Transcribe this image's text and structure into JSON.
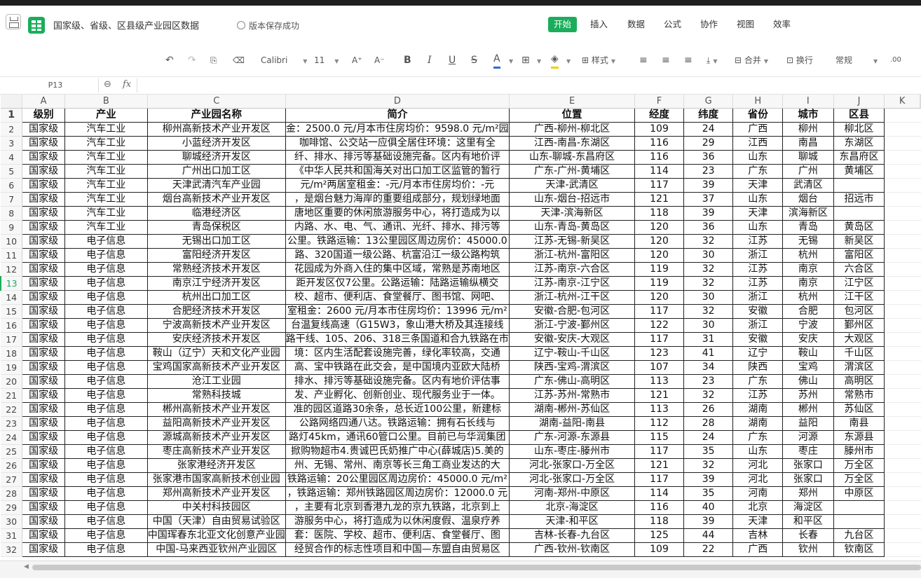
{
  "app": {
    "doc_title": "国家级、省级、区县级产业园区数据",
    "save_status": "版本保存成功",
    "menus": [
      "开始",
      "插入",
      "数据",
      "公式",
      "协作",
      "视图",
      "效率"
    ],
    "active_menu": "开始",
    "accent_color": "#1aad5b"
  },
  "toolbar": {
    "font_name": "Calibri",
    "font_size": "11",
    "style_label": "样式",
    "merge_label": "合并",
    "wrap_label": "换行",
    "format_label": "常规",
    "icons": [
      "undo-icon",
      "redo-icon",
      "format-painter-icon",
      "eraser-icon",
      "font-grow-icon",
      "font-shrink-icon",
      "bold-icon",
      "italic-icon",
      "underline-icon",
      "strikethrough-icon",
      "font-color-icon",
      "border-icon",
      "fill-color-icon",
      "align-left-icon",
      "align-center-icon",
      "align-right-icon",
      "valign-icon",
      "merge-icon",
      "wrap-icon",
      "decimal-icon"
    ]
  },
  "formula_bar": {
    "cell_ref": "P13",
    "fx": "fx",
    "value": ""
  },
  "sheet": {
    "columns": [
      "A",
      "B",
      "C",
      "D",
      "E",
      "F",
      "G",
      "H",
      "I",
      "J",
      "K"
    ],
    "selected_row": 13,
    "rows": [
      [
        "级别",
        "产业",
        "产业园名称",
        "简介",
        "位置",
        "经度",
        "纬度",
        "省份",
        "城市",
        "区县"
      ],
      [
        "国家级",
        "汽车工业",
        "柳州高新技术产业开发区",
        "金：2500.0 元/月本市住房均价：9598.0 元/m²园",
        "广西-柳州-柳北区",
        "109",
        "24",
        "广西",
        "柳州",
        "柳北区"
      ],
      [
        "国家级",
        "汽车工业",
        "小蓝经济开发区",
        "咖啡馆、公交站一应俱全居住环境：这里有全",
        "江西-南昌-东湖区",
        "116",
        "29",
        "江西",
        "南昌",
        "东湖区"
      ],
      [
        "国家级",
        "汽车工业",
        "聊城经济开发区",
        "纤、排水、排污等基础设施完备。区内有地价评",
        "山东-聊城-东昌府区",
        "116",
        "36",
        "山东",
        "聊城",
        "东昌府区"
      ],
      [
        "国家级",
        "汽车工业",
        "广州出口加工区",
        "《中华人民共和国海关对出口加工区监管的暂行",
        "广东-广州-黄埔区",
        "114",
        "23",
        "广东",
        "广州",
        "黄埔区"
      ],
      [
        "国家级",
        "汽车工业",
        "天津武清汽车产业园",
        "元/m²两居室租金：-元/月本市住房均价：-元",
        "天津-武清区",
        "117",
        "39",
        "天津",
        "武清区",
        ""
      ],
      [
        "国家级",
        "汽车工业",
        "烟台高新技术产业开发区",
        "，是烟台魅力海岸的重要组成部分，规划绿地面",
        "山东-烟台-招远市",
        "121",
        "37",
        "山东",
        "烟台",
        "招远市"
      ],
      [
        "国家级",
        "汽车工业",
        "临港经济区",
        "唐地区重要的休闲旅游服务中心，将打造成为以",
        "天津-滨海新区",
        "118",
        "39",
        "天津",
        "滨海新区",
        ""
      ],
      [
        "国家级",
        "汽车工业",
        "青岛保税区",
        "内路、水、电、气、通讯、光纤、排水、排污等",
        "山东-青岛-黄岛区",
        "120",
        "36",
        "山东",
        "青岛",
        "黄岛区"
      ],
      [
        "国家级",
        "电子信息",
        "无锡出口加工区",
        "公里。铁路运输：13公里园区周边房价：45000.0",
        "江苏-无锡-新吴区",
        "120",
        "32",
        "江苏",
        "无锡",
        "新吴区"
      ],
      [
        "国家级",
        "电子信息",
        "富阳经济开发区",
        "路、320国道一级公路、杭富沿江一级公路构筑",
        "浙江-杭州-富阳区",
        "120",
        "30",
        "浙江",
        "杭州",
        "富阳区"
      ],
      [
        "国家级",
        "电子信息",
        "常熟经济技术开发区",
        "花园成为外商入住的集中区域，常熟是苏南地区",
        "江苏-南京-六合区",
        "119",
        "32",
        "江苏",
        "南京",
        "六合区"
      ],
      [
        "国家级",
        "电子信息",
        "南京江宁经济开发区",
        "距开发区仅7公里。公路运输：陆路运输纵横交",
        "江苏-南京-江宁区",
        "119",
        "32",
        "江苏",
        "南京",
        "江宁区"
      ],
      [
        "国家级",
        "电子信息",
        "杭州出口加工区",
        "校、超市、便利店、食堂餐厅、图书馆、网吧、",
        "浙江-杭州-江干区",
        "120",
        "30",
        "浙江",
        "杭州",
        "江干区"
      ],
      [
        "国家级",
        "电子信息",
        "合肥经济技术开发区",
        "室租金：2600 元/月本市住房均价：13996 元/m²",
        "安徽-合肥-包河区",
        "117",
        "32",
        "安徽",
        "合肥",
        "包河区"
      ],
      [
        "国家级",
        "电子信息",
        "宁波高新技术产业开发区",
        "台温复线高速（G15W3，象山港大桥及其连接线",
        "浙江-宁波-鄞州区",
        "122",
        "30",
        "浙江",
        "宁波",
        "鄞州区"
      ],
      [
        "国家级",
        "电子信息",
        "安庆经济技术开发区",
        "路干线、105、206、318三条国道和合九铁路在市",
        "安徽-安庆-大观区",
        "117",
        "31",
        "安徽",
        "安庆",
        "大观区"
      ],
      [
        "国家级",
        "电子信息",
        "鞍山（辽宁）天和文化产业园",
        "境：区内生活配套设施完善，绿化率较高，交通",
        "辽宁-鞍山-千山区",
        "123",
        "41",
        "辽宁",
        "鞍山",
        "千山区"
      ],
      [
        "国家级",
        "电子信息",
        "宝鸡国家高新技术产业开发区",
        "高、宝中铁路在此交会，是中国境内亚欧大陆桥",
        "陕西-宝鸡-渭滨区",
        "107",
        "34",
        "陕西",
        "宝鸡",
        "渭滨区"
      ],
      [
        "国家级",
        "电子信息",
        "沧江工业园",
        "排水、排污等基础设施完备。区内有地价评估事",
        "广东-佛山-高明区",
        "113",
        "23",
        "广东",
        "佛山",
        "高明区"
      ],
      [
        "国家级",
        "电子信息",
        "常熟科技城",
        "发、产业孵化、创新创业、现代服务业于一体。",
        "江苏-苏州-常熟市",
        "121",
        "32",
        "江苏",
        "苏州",
        "常熟市"
      ],
      [
        "国家级",
        "电子信息",
        "郴州高新技术产业开发区",
        "准的园区道路30余条，总长近100公里，新建标",
        "湖南-郴州-苏仙区",
        "113",
        "26",
        "湖南",
        "郴州",
        "苏仙区"
      ],
      [
        "国家级",
        "电子信息",
        "益阳高新技术产业开发区",
        "公路网络四通八达。铁路运输：拥有石长线与",
        "湖南-益阳-南县",
        "112",
        "28",
        "湖南",
        "益阳",
        "南县"
      ],
      [
        "国家级",
        "电子信息",
        "源城高新技术产业开发区",
        "路灯45km，通讯60管口公里。目前已与华润集团",
        "广东-河源-东源县",
        "115",
        "24",
        "广东",
        "河源",
        "东源县"
      ],
      [
        "国家级",
        "电子信息",
        "枣庄高新技术产业开发区",
        "掀购物超市4.贵诚巴氏奶推广中心(薛城店)5.美的",
        "山东-枣庄-滕州市",
        "117",
        "35",
        "山东",
        "枣庄",
        "滕州市"
      ],
      [
        "国家级",
        "电子信息",
        "张家港经济开发区",
        "州、无锡、常州、南京等长三角工商业发达的大",
        "河北-张家口-万全区",
        "121",
        "32",
        "河北",
        "张家口",
        "万全区"
      ],
      [
        "国家级",
        "电子信息",
        "张家港市国家高新技术创业园",
        "铁路运输：20公里园区周边房价：45000.0 元/m²",
        "河北-张家口-万全区",
        "117",
        "39",
        "河北",
        "张家口",
        "万全区"
      ],
      [
        "国家级",
        "电子信息",
        "郑州高新技术产业开发区",
        "，铁路运输：郑州铁路园区周边房价：12000.0 元",
        "河南-郑州-中原区",
        "114",
        "35",
        "河南",
        "郑州",
        "中原区"
      ],
      [
        "国家级",
        "电子信息",
        "中关村科技园区",
        "，主要有北京到香港九龙的京九铁路，北京到上",
        "北京-海淀区",
        "116",
        "40",
        "北京",
        "海淀区",
        ""
      ],
      [
        "国家级",
        "电子信息",
        "中国（天津）自由贸易试验区",
        "游服务中心，将打造成为以休闲度假、温泉疗养",
        "天津-和平区",
        "118",
        "39",
        "天津",
        "和平区",
        ""
      ],
      [
        "国家级",
        "电子信息",
        "中国珲春东北亚文化创意产业园",
        "套：医院、学校、超市、便利店、食堂餐厅、图",
        "吉林-长春-九台区",
        "125",
        "44",
        "吉林",
        "长春",
        "九台区"
      ],
      [
        "国家级",
        "电子信息",
        "中国-马来西亚钦州产业园区",
        "经贸合作的标志性项目和中国—东盟自由贸易区",
        "广西-钦州-钦南区",
        "109",
        "22",
        "广西",
        "钦州",
        "钦南区"
      ]
    ]
  }
}
